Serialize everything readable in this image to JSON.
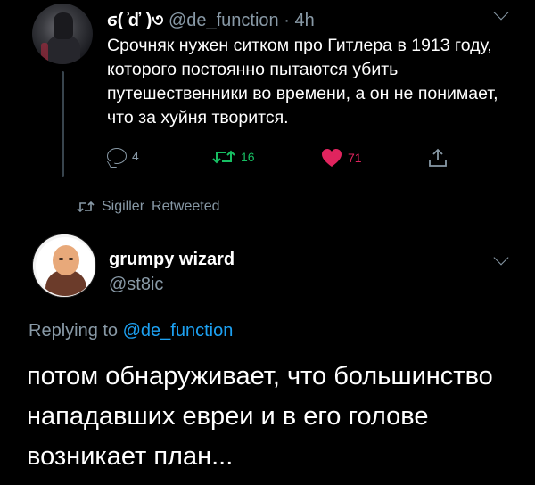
{
  "tweet1": {
    "display_name": "ϭ( ͗ď )৩",
    "handle": "@de_function",
    "separator": " · ",
    "time": "4h",
    "text": "Срочняк нужен ситком про Гитлера в 1913 году, которого постоянно пытаются убить путешественники во времени, а он не понимает, что за хуйня творится.",
    "replies": "4",
    "retweets": "16",
    "likes": "71"
  },
  "retweet_notice": {
    "user": "Sigiller",
    "label": "Retweeted"
  },
  "tweet2": {
    "display_name": "grumpy wizard",
    "handle": "@st8ic",
    "replying_prefix": "Replying to ",
    "replying_to": "@de_function",
    "text": "потом обнаруживает, что большинство нападавших евреи и в его голове возникает план..."
  },
  "colors": {
    "background": "#000000",
    "secondary_text": "#8899a6",
    "link": "#1da1f2",
    "retweet": "#17bf63",
    "like": "#e0245e"
  }
}
